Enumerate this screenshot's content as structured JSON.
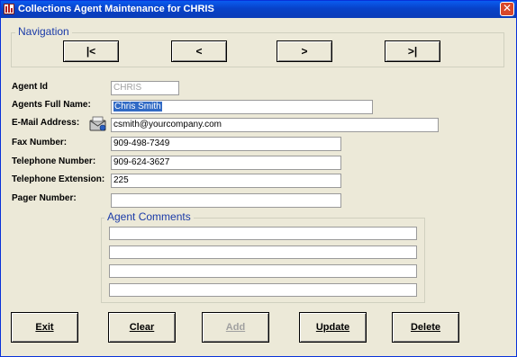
{
  "window": {
    "title": "Collections Agent Maintenance for CHRIS",
    "close_glyph": "✕"
  },
  "navigation": {
    "title": "Navigation",
    "first_label": "|<",
    "prev_label": "<",
    "next_label": ">",
    "last_label": ">|"
  },
  "form": {
    "agent_id": {
      "label": "Agent Id",
      "value": "CHRIS"
    },
    "full_name": {
      "label": "Agents Full Name:",
      "value": "Chris Smith"
    },
    "email": {
      "label": "E-Mail Address:",
      "value": "csmith@yourcompany.com"
    },
    "fax": {
      "label": "Fax Number:",
      "value": "909-498-7349"
    },
    "telephone": {
      "label": "Telephone Number:",
      "value": "909-624-3627"
    },
    "extension": {
      "label": "Telephone Extension:",
      "value": "225"
    },
    "pager": {
      "label": "Pager Number:",
      "value": ""
    }
  },
  "comments": {
    "title": "Agent Comments",
    "lines": [
      "",
      "",
      "",
      ""
    ]
  },
  "actions": {
    "exit_label": "Exit",
    "clear_label": "Clear",
    "add_label": "Add",
    "update_label": "Update",
    "delete_label": "Delete"
  },
  "colors": {
    "titlebar": "#0842c8",
    "face": "#ece9d8",
    "legend": "#1a3aa8",
    "selection": "#316ac5",
    "close": "#d8472a"
  },
  "icons": {
    "app": "app-bars-icon",
    "email": "email-envelope-icon",
    "close": "close-icon"
  }
}
